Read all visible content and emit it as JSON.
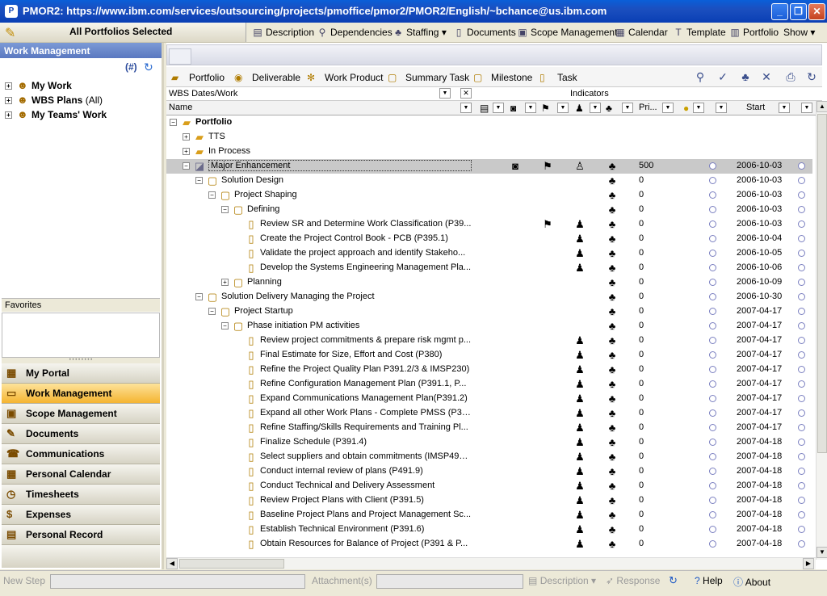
{
  "window": {
    "title": "PMOR2: https://www.ibm.com/services/outsourcing/projects/pmoffice/pmor2/PMOR2/English/~bchance@us.ibm.com"
  },
  "topbar": {
    "selection": "All Portfolios Selected",
    "items": [
      {
        "label": "Description",
        "icon": "description-icon"
      },
      {
        "label": "Dependencies",
        "icon": "dependencies-icon"
      },
      {
        "label": "Staffing",
        "icon": "staffing-icon"
      },
      {
        "label": "Documents",
        "icon": "documents-icon"
      },
      {
        "label": "Scope Management",
        "icon": "scope-icon"
      },
      {
        "label": "Calendar",
        "icon": "calendar-icon"
      },
      {
        "label": "Template",
        "icon": "template-icon"
      },
      {
        "label": "Portfolio",
        "icon": "portfolio-icon"
      },
      {
        "label": "Show",
        "icon": ""
      }
    ]
  },
  "left": {
    "header": "Work Management",
    "count_label": "(#)",
    "tree": [
      {
        "label": "My Work",
        "suffix": ""
      },
      {
        "label": "WBS Plans",
        "suffix": "(All)"
      },
      {
        "label": "My Teams' Work",
        "suffix": ""
      }
    ],
    "favorites": "Favorites",
    "nav": [
      {
        "label": "My Portal",
        "active": false
      },
      {
        "label": "Work Management",
        "active": true
      },
      {
        "label": "Scope Management",
        "active": false
      },
      {
        "label": "Documents",
        "active": false
      },
      {
        "label": "Communications",
        "active": false
      },
      {
        "label": "Personal Calendar",
        "active": false
      },
      {
        "label": "Timesheets",
        "active": false
      },
      {
        "label": "Expenses",
        "active": false
      },
      {
        "label": "Personal Record",
        "active": false
      }
    ]
  },
  "types": [
    "Portfolio",
    "Deliverable",
    "Work Product",
    "Summary Task",
    "Milestone",
    "Task"
  ],
  "grid": {
    "view": "WBS Dates/Work",
    "indicators_label": "Indicators",
    "col_name": "Name",
    "col_pri": "Pri...",
    "col_start": "Start",
    "rows": [
      {
        "name": "Portfolio",
        "level": 0,
        "pm": "-",
        "icon": "folder",
        "bold": true,
        "pri": "",
        "start": ""
      },
      {
        "name": "TTS",
        "level": 1,
        "pm": "+",
        "icon": "folder",
        "pri": "",
        "start": ""
      },
      {
        "name": "In Process",
        "level": 1,
        "pm": "+",
        "icon": "folder",
        "pri": "",
        "start": ""
      },
      {
        "name": "Major Enhancement",
        "level": 1,
        "pm": "-",
        "icon": "deliverable",
        "sel": true,
        "pri": "500",
        "start": "2006-10-03",
        "ind": [
          "doc",
          "flag",
          "person",
          "staff"
        ]
      },
      {
        "name": "Solution Design",
        "level": 2,
        "pm": "-",
        "icon": "summary",
        "pri": "0",
        "start": "2006-10-03",
        "ind": [
          "staff"
        ]
      },
      {
        "name": "Project Shaping",
        "level": 3,
        "pm": "-",
        "icon": "summary",
        "pri": "0",
        "start": "2006-10-03",
        "ind": [
          "staff"
        ]
      },
      {
        "name": "Defining",
        "level": 4,
        "pm": "-",
        "icon": "summary",
        "pri": "0",
        "start": "2006-10-03",
        "ind": [
          "staff"
        ]
      },
      {
        "name": "Review SR and Determine Work Classification (P39...",
        "level": 5,
        "pm": "",
        "icon": "task",
        "pri": "0",
        "start": "2006-10-03",
        "ind": [
          "flag",
          "people",
          "staff"
        ]
      },
      {
        "name": "Create the Project Control Book - PCB (P395.1)",
        "level": 5,
        "pm": "",
        "icon": "task",
        "pri": "0",
        "start": "2006-10-04",
        "ind": [
          "people",
          "staff"
        ]
      },
      {
        "name": "Validate the project approach and identify Stakeho...",
        "level": 5,
        "pm": "",
        "icon": "task",
        "pri": "0",
        "start": "2006-10-05",
        "ind": [
          "people",
          "staff"
        ]
      },
      {
        "name": "Develop the Systems Engineering Management Pla...",
        "level": 5,
        "pm": "",
        "icon": "task",
        "pri": "0",
        "start": "2006-10-06",
        "ind": [
          "people",
          "staff"
        ]
      },
      {
        "name": "Planning",
        "level": 4,
        "pm": "+",
        "icon": "summary",
        "pri": "0",
        "start": "2006-10-09",
        "ind": [
          "staff"
        ]
      },
      {
        "name": "Solution Delivery Managing the Project",
        "level": 2,
        "pm": "-",
        "icon": "summary",
        "pri": "0",
        "start": "2006-10-30",
        "ind": [
          "staff"
        ]
      },
      {
        "name": "Project Startup",
        "level": 3,
        "pm": "-",
        "icon": "summary",
        "pri": "0",
        "start": "2007-04-17",
        "ind": [
          "staff"
        ]
      },
      {
        "name": "Phase initiation PM activities",
        "level": 4,
        "pm": "-",
        "icon": "summary",
        "pri": "0",
        "start": "2007-04-17",
        "ind": [
          "staff"
        ]
      },
      {
        "name": "Review project commitments & prepare risk mgmt p...",
        "level": 5,
        "pm": "",
        "icon": "task",
        "pri": "0",
        "start": "2007-04-17",
        "ind": [
          "people",
          "staff"
        ]
      },
      {
        "name": "Final Estimate for Size, Effort and Cost (P380)",
        "level": 5,
        "pm": "",
        "icon": "task",
        "pri": "0",
        "start": "2007-04-17",
        "ind": [
          "people",
          "staff"
        ]
      },
      {
        "name": "Refine the Project Quality Plan P391.2/3 & IMSP230)",
        "level": 5,
        "pm": "",
        "icon": "task",
        "pri": "0",
        "start": "2007-04-17",
        "ind": [
          "people",
          "staff"
        ]
      },
      {
        "name": "Refine Configuration Management Plan (P391.1, P...",
        "level": 5,
        "pm": "",
        "icon": "task",
        "pri": "0",
        "start": "2007-04-17",
        "ind": [
          "people",
          "staff"
        ]
      },
      {
        "name": "Expand Communications Management Plan(P391.2)",
        "level": 5,
        "pm": "",
        "icon": "task",
        "pri": "0",
        "start": "2007-04-17",
        "ind": [
          "people",
          "staff"
        ]
      },
      {
        "name": "Expand all other Work Plans - Complete PMSS (P39...",
        "level": 5,
        "pm": "",
        "icon": "task",
        "pri": "0",
        "start": "2007-04-17",
        "ind": [
          "people",
          "staff"
        ]
      },
      {
        "name": "Refine Staffing/Skills Requirements and Training Pl...",
        "level": 5,
        "pm": "",
        "icon": "task",
        "pri": "0",
        "start": "2007-04-17",
        "ind": [
          "people",
          "staff"
        ]
      },
      {
        "name": "Finalize Schedule (P391.4)",
        "level": 5,
        "pm": "",
        "icon": "task",
        "pri": "0",
        "start": "2007-04-18",
        "ind": [
          "people",
          "staff"
        ]
      },
      {
        "name": "Select suppliers and obtain commitments (IMSP491 ...",
        "level": 5,
        "pm": "",
        "icon": "task",
        "pri": "0",
        "start": "2007-04-18",
        "ind": [
          "people",
          "staff"
        ]
      },
      {
        "name": "Conduct internal review of plans (P491.9)",
        "level": 5,
        "pm": "",
        "icon": "task",
        "pri": "0",
        "start": "2007-04-18",
        "ind": [
          "people",
          "staff"
        ]
      },
      {
        "name": "Conduct Technical and Delivery Assessment",
        "level": 5,
        "pm": "",
        "icon": "task",
        "pri": "0",
        "start": "2007-04-18",
        "ind": [
          "people",
          "staff"
        ]
      },
      {
        "name": "Review Project Plans with Client (P391.5)",
        "level": 5,
        "pm": "",
        "icon": "task",
        "pri": "0",
        "start": "2007-04-18",
        "ind": [
          "people",
          "staff"
        ]
      },
      {
        "name": "Baseline Project Plans and Project Management Sc...",
        "level": 5,
        "pm": "",
        "icon": "task",
        "pri": "0",
        "start": "2007-04-18",
        "ind": [
          "people",
          "staff"
        ]
      },
      {
        "name": "Establish Technical Environment (P391.6)",
        "level": 5,
        "pm": "",
        "icon": "task",
        "pri": "0",
        "start": "2007-04-18",
        "ind": [
          "people",
          "staff"
        ]
      },
      {
        "name": "Obtain Resources for Balance of Project (P391 & P...",
        "level": 5,
        "pm": "",
        "icon": "task",
        "pri": "0",
        "start": "2007-04-18",
        "ind": [
          "people",
          "staff"
        ]
      }
    ]
  },
  "status": {
    "new_step": "New Step",
    "attachments": "Attachment(s)",
    "description": "Description",
    "response": "Response",
    "help": "Help",
    "about": "About"
  }
}
